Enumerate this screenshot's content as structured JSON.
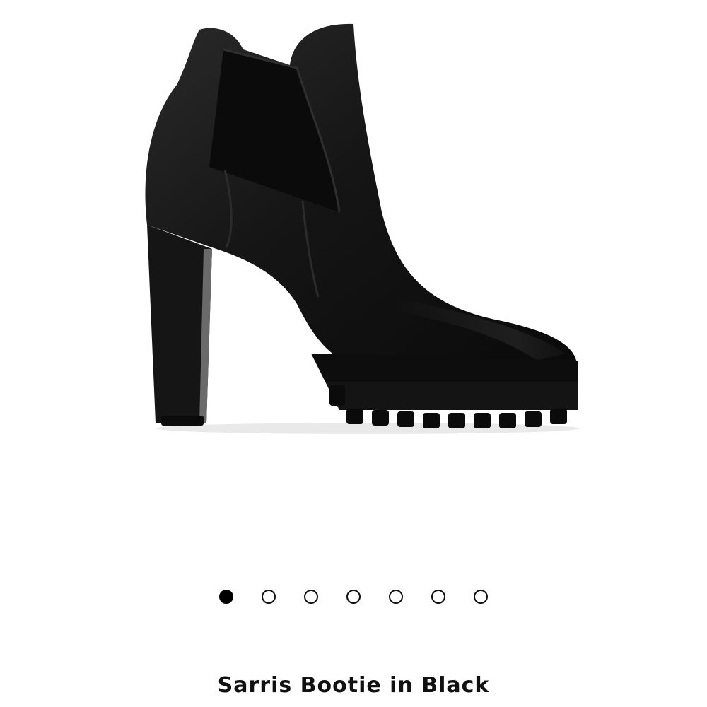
{
  "product": {
    "image_alt": "Sarris Bootie in Black",
    "title": "Sarris Bootie in Black"
  },
  "carousel": {
    "count": 7,
    "active_index": 0
  },
  "colors": {
    "background": "#ffffff",
    "boot": "#101010",
    "active_dot": "#000000"
  }
}
